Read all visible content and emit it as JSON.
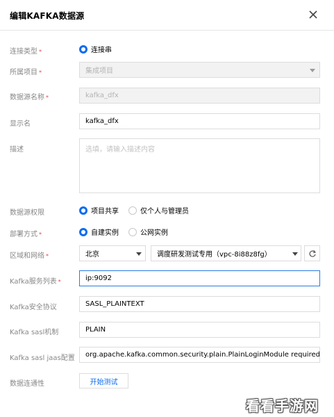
{
  "dialog": {
    "title": "编辑KAFKA数据源"
  },
  "form": {
    "connection_type": {
      "label": "连接类型",
      "options": [
        "连接串"
      ],
      "selected": "连接串"
    },
    "project": {
      "label": "所属项目",
      "value": "集成项目"
    },
    "datasource_name": {
      "label": "数据源名称",
      "value": "kafka_dfx"
    },
    "display_name": {
      "label": "显示名",
      "value": "kafka_dfx"
    },
    "description": {
      "label": "描述",
      "placeholder": "选填，请输入描述内容"
    },
    "permission": {
      "label": "数据源权限",
      "options": [
        "项目共享",
        "仅个人与管理员"
      ],
      "selected": "项目共享"
    },
    "deployment": {
      "label": "部署方式",
      "options": [
        "自建实例",
        "公网实例"
      ],
      "selected": "自建实例"
    },
    "region_network": {
      "label": "区域和网络",
      "region": "北京",
      "network": "调度研发测试专用（vpc-8i88z8fg）"
    },
    "kafka_servers": {
      "label": "Kafka服务列表",
      "value": "ip:9092"
    },
    "security_protocol": {
      "label": "Kafka安全协议",
      "value": "SASL_PLAINTEXT"
    },
    "sasl_mechanism": {
      "label": "Kafka sasl机制",
      "value": "PLAIN"
    },
    "sasl_jaas": {
      "label": "Kafka sasl jaas配置",
      "value": "org.apache.kafka.common.security.plain.PlainLoginModule required usernam"
    },
    "connectivity": {
      "label": "数据连通性",
      "button": "开始测试"
    }
  },
  "watermark": "看看手游网",
  "colors": {
    "accent": "#0a6cf0",
    "required": "#e54545",
    "focus_border": "#2b7ae0"
  }
}
